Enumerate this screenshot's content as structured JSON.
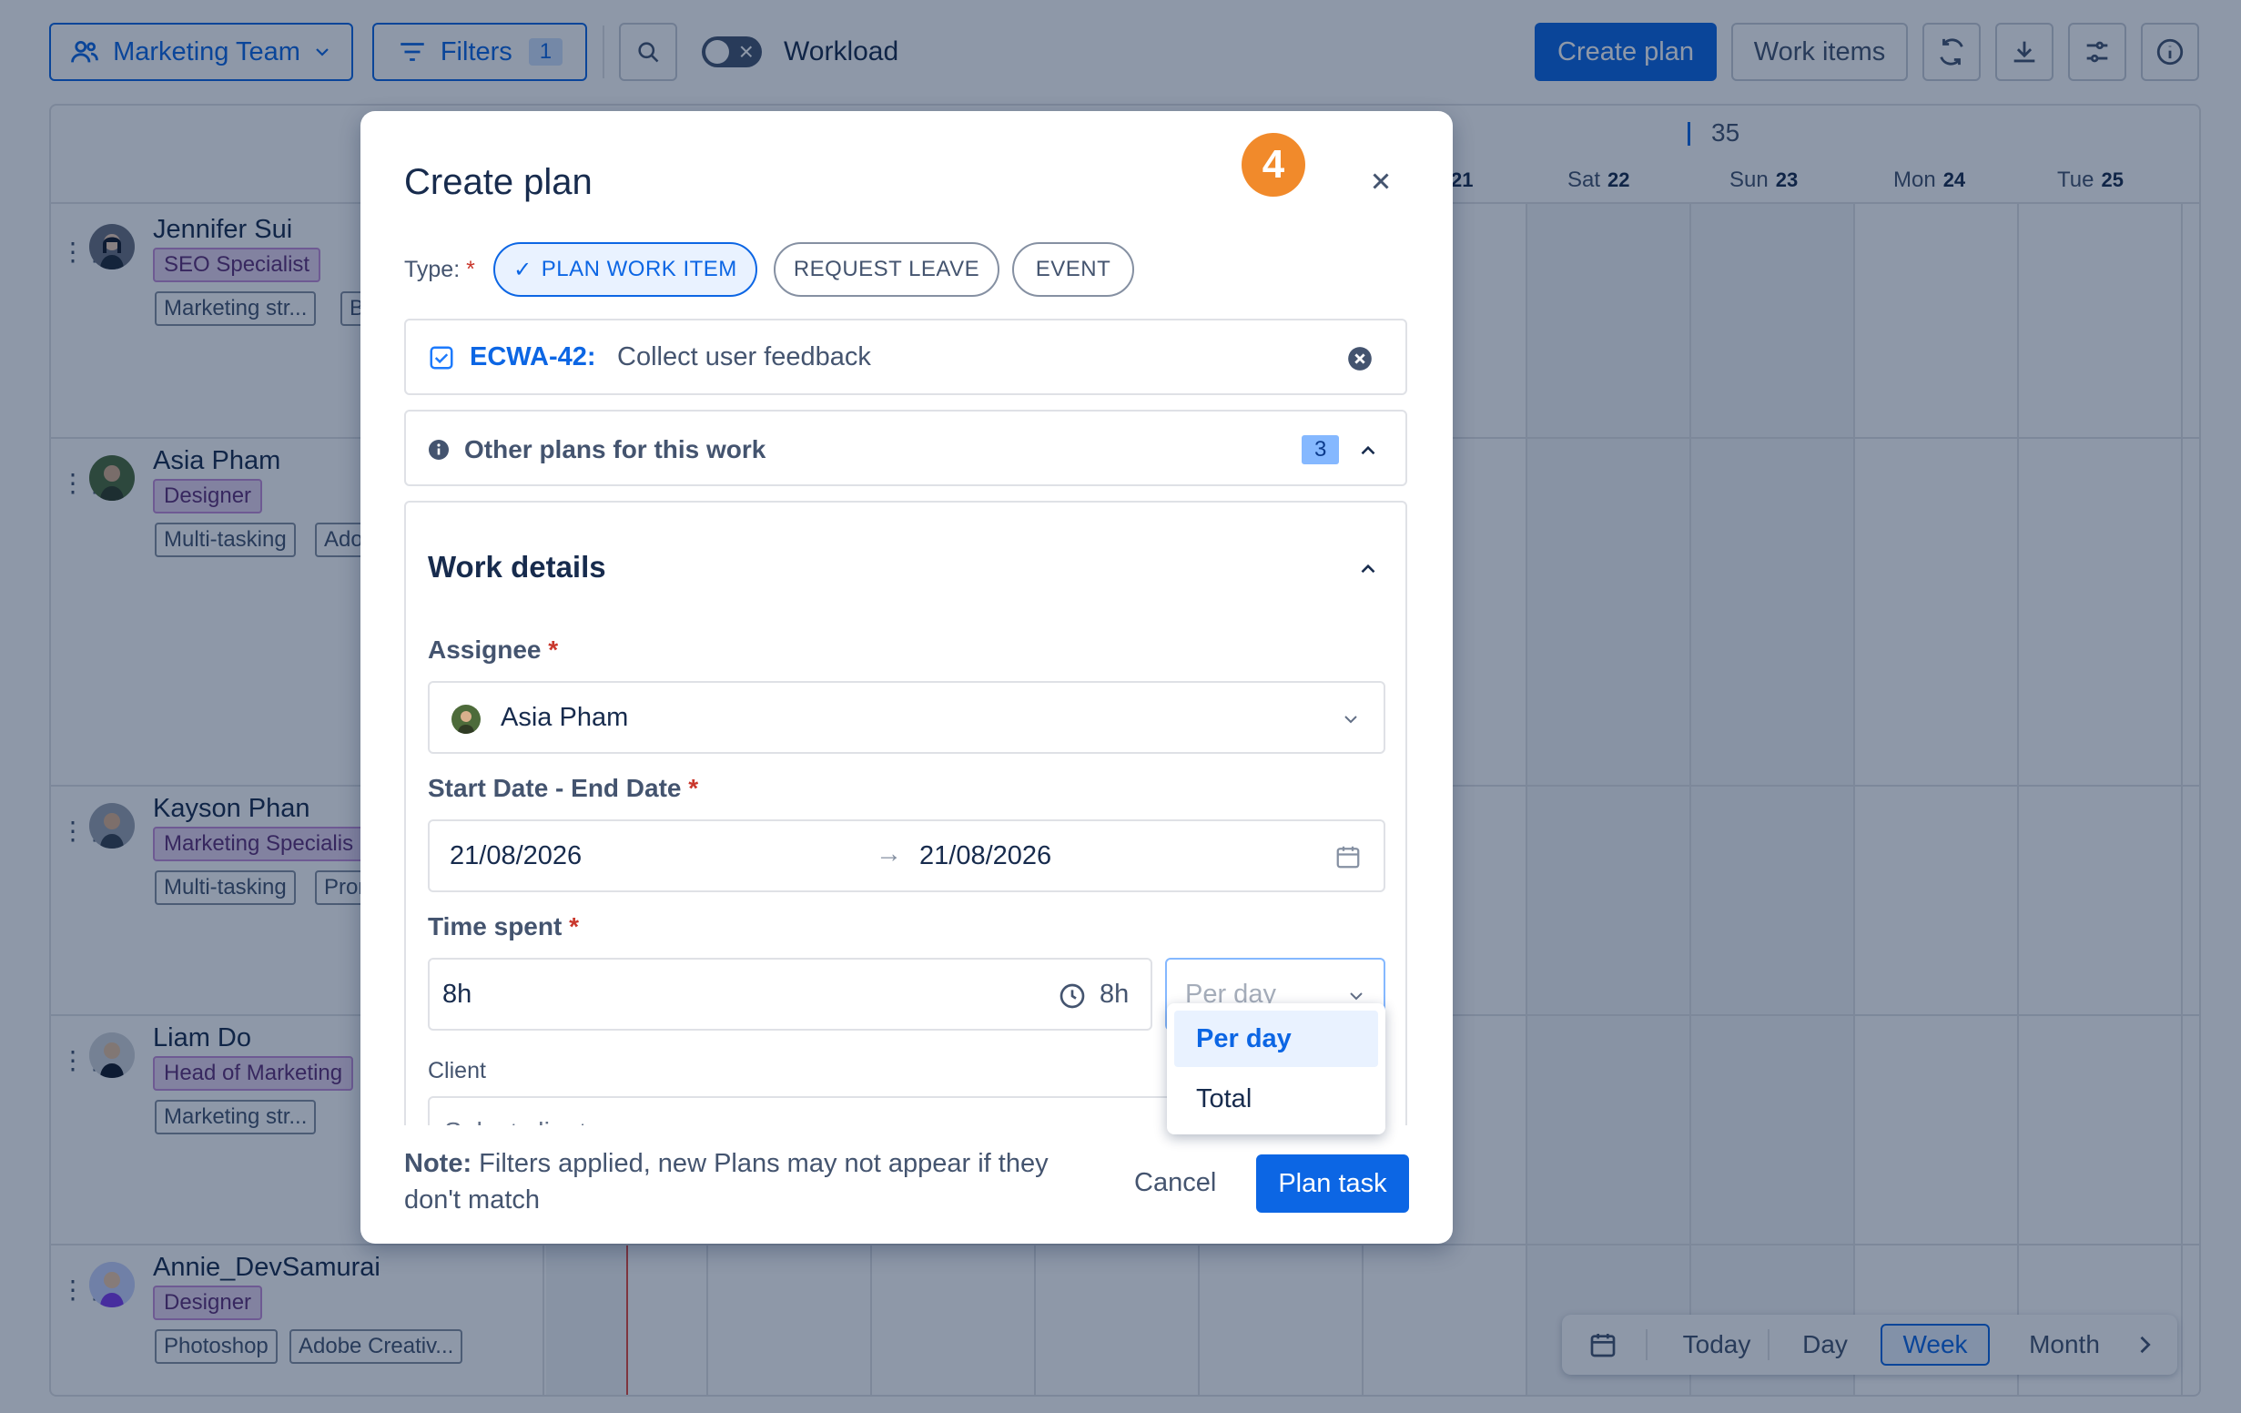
{
  "toolbar": {
    "team_label": "Marketing Team",
    "filters_label": "Filters",
    "filters_count": "1",
    "workload_label": "Workload",
    "create_plan_label": "Create plan",
    "work_items_label": "Work items"
  },
  "timeline": {
    "week_number": "35",
    "days": [
      {
        "name": "",
        "num": "21"
      },
      {
        "name": "Sat",
        "num": "22"
      },
      {
        "name": "Sun",
        "num": "23"
      },
      {
        "name": "Mon",
        "num": "24"
      },
      {
        "name": "Tue",
        "num": "25"
      }
    ]
  },
  "people": [
    {
      "name": "Jennifer Sui",
      "role": "SEO Specialist",
      "skills": [
        "Marketing str...",
        "B"
      ]
    },
    {
      "name": "Asia Pham",
      "role": "Designer",
      "skills": [
        "Multi-tasking",
        "Ado"
      ]
    },
    {
      "name": "Kayson Phan",
      "role": "Marketing Specialis",
      "skills": [
        "Multi-tasking",
        "Pror"
      ]
    },
    {
      "name": "Liam Do",
      "role": "Head of Marketing",
      "skills": [
        "Marketing str..."
      ]
    },
    {
      "name": "Annie_DevSamurai",
      "role": "Designer",
      "skills": [
        "Photoshop",
        "Adobe Creativ..."
      ]
    }
  ],
  "bottom_nav": {
    "today": "Today",
    "day": "Day",
    "week": "Week",
    "month": "Month"
  },
  "modal": {
    "title": "Create plan",
    "step_badge": "4",
    "type_label": "Type:",
    "required_mark": "*",
    "types": [
      "PLAN WORK ITEM",
      "REQUEST LEAVE",
      "EVENT"
    ],
    "selected_type_check": "✓",
    "work_item": {
      "key": "ECWA-42:",
      "title": "Collect user feedback"
    },
    "other_plans": {
      "label": "Other plans for this work",
      "count": "3"
    },
    "work_details": {
      "title": "Work details",
      "assignee_label": "Assignee",
      "assignee_value": "Asia Pham",
      "dates_label": "Start Date - End Date",
      "start_date": "21/08/2026",
      "end_date": "21/08/2026",
      "date_arrow": "→",
      "time_label": "Time spent",
      "time_value": "8h",
      "time_hint": "8h",
      "per_placeholder": "Per day",
      "client_label": "Client",
      "client_placeholder": "Select clients"
    },
    "note_bold": "Note:",
    "note_text": " Filters applied, new Plans may not appear if they don't match",
    "cancel_label": "Cancel",
    "submit_label": "Plan task"
  },
  "per_dropdown": {
    "options": [
      "Per day",
      "Total"
    ],
    "selected": "Per day"
  },
  "colors": {
    "primary": "#0c66e4",
    "badge_orange": "#f18a2b",
    "role_tag_bg": "#e9d7f0"
  }
}
